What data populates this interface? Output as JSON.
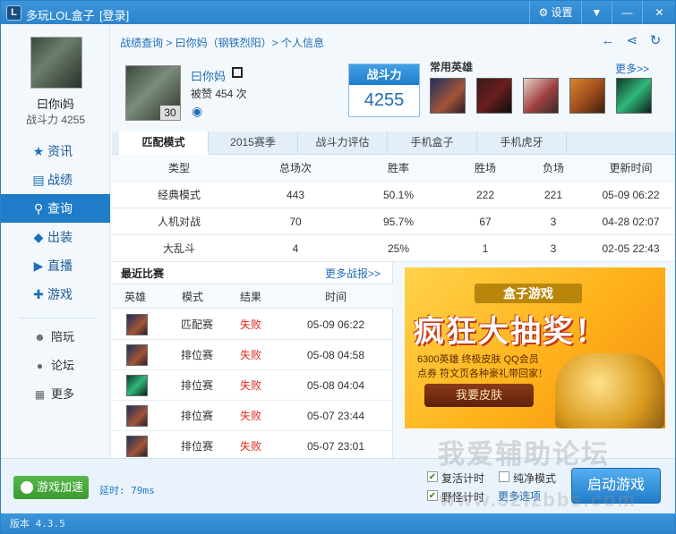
{
  "titlebar": {
    "logo": "L",
    "title": "多玩LOL盒子",
    "login": "[登录]",
    "settings": "设置",
    "settings_icon": "gear-icon"
  },
  "sidebar": {
    "username": "曰你i妈",
    "power": "战斗力 4255",
    "items": [
      {
        "label": "资讯",
        "icon": "star-icon"
      },
      {
        "label": "战绩",
        "icon": "record-icon"
      },
      {
        "label": "查询",
        "icon": "search-icon"
      },
      {
        "label": "出装",
        "icon": "equipment-icon"
      },
      {
        "label": "直播",
        "icon": "play-icon"
      },
      {
        "label": "游戏",
        "icon": "gamepad-icon"
      }
    ],
    "subitems": [
      {
        "label": "陪玩",
        "icon": "people-icon"
      },
      {
        "label": "论坛",
        "icon": "chat-icon"
      },
      {
        "label": "更多",
        "icon": "grid-icon"
      }
    ]
  },
  "breadcrumb": "战绩查询 > 曰你妈（钢铁烈阳）> 个人信息",
  "profile": {
    "name": "曰你妈",
    "likes": "被赞 454 次",
    "level": "30"
  },
  "power_box": {
    "label": "战斗力",
    "value": "4255"
  },
  "heroes": {
    "title": "常用英雄",
    "more": "更多>>"
  },
  "tabs": [
    "匹配模式",
    "2015赛季",
    "战斗力评估",
    "手机盒子",
    "手机虎牙"
  ],
  "stats": {
    "headers": [
      "类型",
      "总场次",
      "胜率",
      "胜场",
      "负场",
      "更新时间"
    ],
    "rows": [
      [
        "经典模式",
        "443",
        "50.1%",
        "222",
        "221",
        "05-09 06:22"
      ],
      [
        "人机对战",
        "70",
        "95.7%",
        "67",
        "3",
        "04-28 02:07"
      ],
      [
        "大乱斗",
        "4",
        "25%",
        "1",
        "3",
        "02-05 22:43"
      ]
    ]
  },
  "recent": {
    "title": "最近比赛",
    "more": "更多战报>>",
    "headers": [
      "英雄",
      "模式",
      "结果",
      "时间"
    ],
    "rows": [
      [
        "匹配赛",
        "失败",
        "05-09 06:22"
      ],
      [
        "排位赛",
        "失败",
        "05-08 04:58"
      ],
      [
        "排位赛",
        "失败",
        "05-08 04:04"
      ],
      [
        "排位赛",
        "失败",
        "05-07 23:44"
      ],
      [
        "排位赛",
        "失败",
        "05-07 23:01"
      ]
    ]
  },
  "ad": {
    "ribbon": "盒子游戏",
    "headline": "疯狂大抽奖！",
    "line1": "6300英雄 终极皮肤 QQ会员",
    "line2": "点券 符文页各种豪礼带回家！",
    "button": "我要皮肤"
  },
  "bottom": {
    "speed_button": "游戏加速",
    "latency": "延时: 79ms",
    "revive_timer": "复活计时",
    "pure_mode": "纯净模式",
    "jungle_timer": "野怪计时",
    "more_options": "更多选项",
    "start": "启动游戏"
  },
  "status": "版本 4.3.5",
  "watermark": "我爱辅助论坛",
  "watermark2": "www.52fzbbs.com",
  "colors": {
    "accent": "#1f7cc8",
    "loss": "#e2281e",
    "start_green": "#3a9a2f"
  }
}
